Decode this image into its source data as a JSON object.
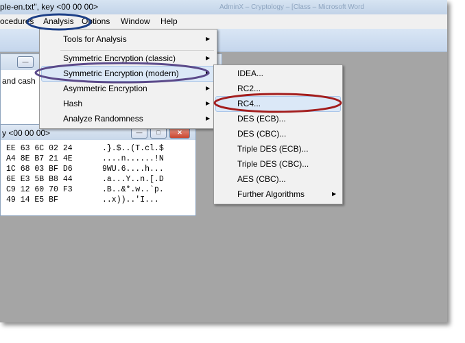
{
  "window": {
    "title": "ple-en.txt\", key <00 00 00>",
    "title_ghost": "AdminX – Cryptology – [Class – Microsoft Word"
  },
  "menubar": {
    "items": [
      "ocedures",
      "Analysis",
      "Options",
      "Window",
      "Help"
    ]
  },
  "bg_window1": {
    "text": "and cash"
  },
  "bg_window2": {
    "title": "y <00 00 00>",
    "min_label": "—",
    "max_label": "□",
    "close_label": "✕",
    "hex_rows": [
      "EE 63 6C 02 24",
      "A4 8E B7 21 4E",
      "1C 68 03 BF D6",
      "6E E3 5B B8 44",
      "C9 12 60 70 F3",
      "49 14 E5 BF"
    ],
    "ascii_rows": [
      ".}.$..(T.cl.$",
      "....n......!N",
      "9WU.6....h...",
      ".a...Y..n.[.D",
      ".B..&*.w..`p.",
      "..x))..'I..."
    ]
  },
  "analysis_menu": {
    "items": [
      "Tools for Analysis",
      "Symmetric Encryption (classic)",
      "Symmetric Encryption (modern)",
      "Asymmetric Encryption",
      "Hash",
      "Analyze Randomness"
    ]
  },
  "modern_submenu": {
    "items": [
      "IDEA...",
      "RC2...",
      "RC4...",
      "DES (ECB)...",
      "DES (CBC)...",
      "Triple DES (ECB)...",
      "Triple DES (CBC)...",
      "AES (CBC)...",
      "Further Algorithms"
    ]
  },
  "colors": {
    "ring_analysis": "#1c3f86",
    "ring_modern": "#5b4a8a",
    "ring_rc4": "#a31d1d"
  }
}
